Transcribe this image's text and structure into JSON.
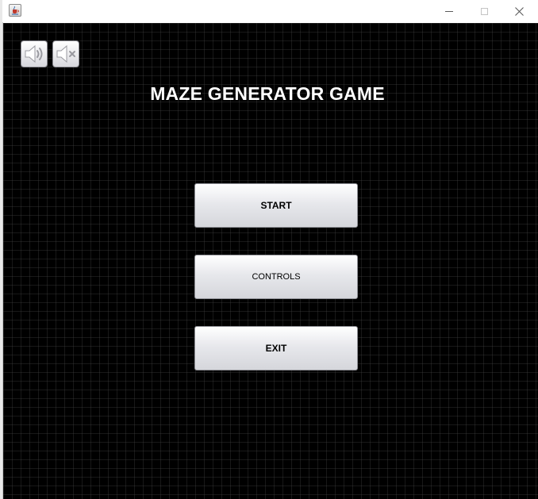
{
  "window": {
    "icon": "java-cup-icon",
    "controls": {
      "minimize_glyph": "—",
      "maximize_glyph": "☐",
      "close_glyph": "✕"
    }
  },
  "game": {
    "title": "MAZE GENERATOR GAME",
    "sound_on_icon": "speaker-on-icon",
    "sound_off_icon": "speaker-muted-icon",
    "buttons": {
      "start": "START",
      "controls": "CONTROLS",
      "exit": "EXIT"
    }
  },
  "colors": {
    "background": "#000000",
    "grid": "#464646",
    "title": "#ffffff",
    "button_top": "#ffffff",
    "button_bottom": "#d5d6db"
  }
}
